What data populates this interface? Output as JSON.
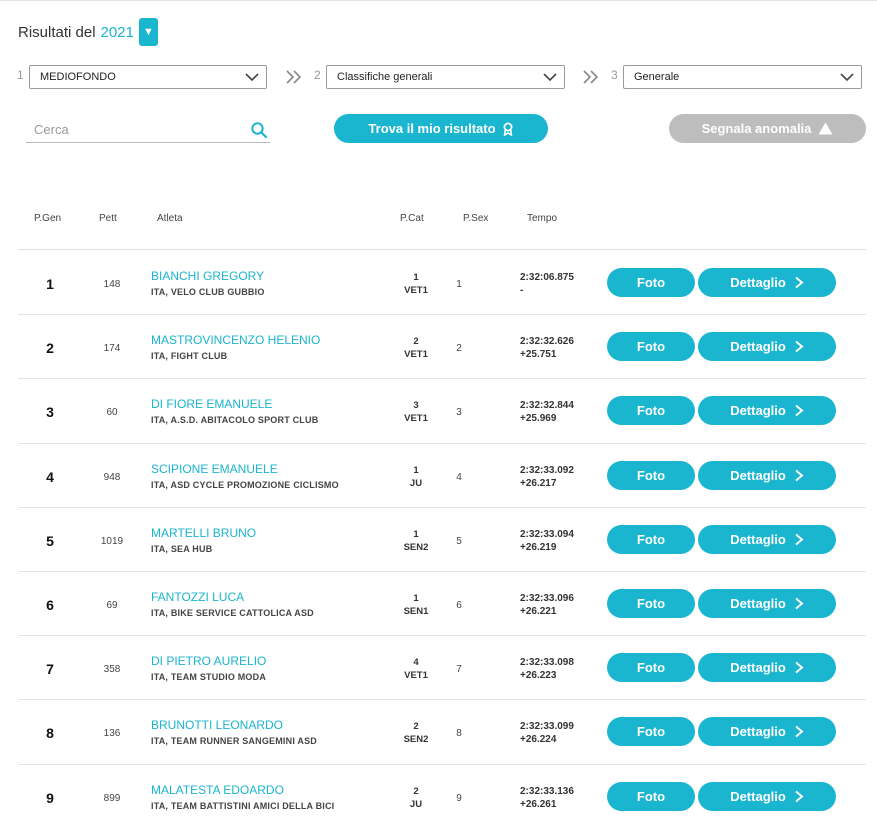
{
  "header": {
    "year_label": "Risultati del",
    "year_value": "2021"
  },
  "steps": [
    {
      "num": "1",
      "value": "MEDIOFONDO"
    },
    {
      "num": "2",
      "value": "Classifiche generali"
    },
    {
      "num": "3",
      "value": "Generale"
    }
  ],
  "search": {
    "placeholder": "Cerca"
  },
  "actions": {
    "find_label": "Trova il mio risultato",
    "report_label": "Segnala anomalia"
  },
  "table": {
    "columns": [
      "P.Gen",
      "Pett",
      "Atleta",
      "P.Cat",
      "P.Sex",
      "Tempo"
    ],
    "foto_label": "Foto",
    "detail_label": "Dettaglio",
    "rows": [
      {
        "pos": "1",
        "pett": "148",
        "name": "BIANCHI GREGORY",
        "team": "ITA, VELO CLUB GUBBIO",
        "cat_pos": "1",
        "cat": "VET1",
        "sex_pos": "1",
        "time": "2:32:06.875",
        "gap": "-"
      },
      {
        "pos": "2",
        "pett": "174",
        "name": "MASTROVINCENZO HELENIO",
        "team": "ITA, FIGHT CLUB",
        "cat_pos": "2",
        "cat": "VET1",
        "sex_pos": "2",
        "time": "2:32:32.626",
        "gap": "+25.751"
      },
      {
        "pos": "3",
        "pett": "60",
        "name": "DI FIORE EMANUELE",
        "team": "ITA, A.S.D. ABITACOLO SPORT CLUB",
        "cat_pos": "3",
        "cat": "VET1",
        "sex_pos": "3",
        "time": "2:32:32.844",
        "gap": "+25.969"
      },
      {
        "pos": "4",
        "pett": "948",
        "name": "SCIPIONE EMANUELE",
        "team": "ITA, ASD CYCLE PROMOZIONE CICLISMO",
        "cat_pos": "1",
        "cat": "JU",
        "sex_pos": "4",
        "time": "2:32:33.092",
        "gap": "+26.217"
      },
      {
        "pos": "5",
        "pett": "1019",
        "name": "MARTELLI BRUNO",
        "team": "ITA, SEA HUB",
        "cat_pos": "1",
        "cat": "SEN2",
        "sex_pos": "5",
        "time": "2:32:33.094",
        "gap": "+26.219"
      },
      {
        "pos": "6",
        "pett": "69",
        "name": "FANTOZZI LUCA",
        "team": "ITA, BIKE SERVICE CATTOLICA ASD",
        "cat_pos": "1",
        "cat": "SEN1",
        "sex_pos": "6",
        "time": "2:32:33.096",
        "gap": "+26.221"
      },
      {
        "pos": "7",
        "pett": "358",
        "name": "DI PIETRO AURELIO",
        "team": "ITA, TEAM STUDIO MODA",
        "cat_pos": "4",
        "cat": "VET1",
        "sex_pos": "7",
        "time": "2:32:33.098",
        "gap": "+26.223"
      },
      {
        "pos": "8",
        "pett": "136",
        "name": "BRUNOTTI LEONARDO",
        "team": "ITA, TEAM RUNNER SANGEMINI ASD",
        "cat_pos": "2",
        "cat": "SEN2",
        "sex_pos": "8",
        "time": "2:32:33.099",
        "gap": "+26.224"
      },
      {
        "pos": "9",
        "pett": "899",
        "name": "MALATESTA EDOARDO",
        "team": "ITA, TEAM BATTISTINI AMICI DELLA BICI",
        "cat_pos": "2",
        "cat": "JU",
        "sex_pos": "9",
        "time": "2:32:33.136",
        "gap": "+26.261"
      }
    ]
  },
  "colors": {
    "accent": "#1ab5cf",
    "muted_button": "#bdbdbd"
  }
}
